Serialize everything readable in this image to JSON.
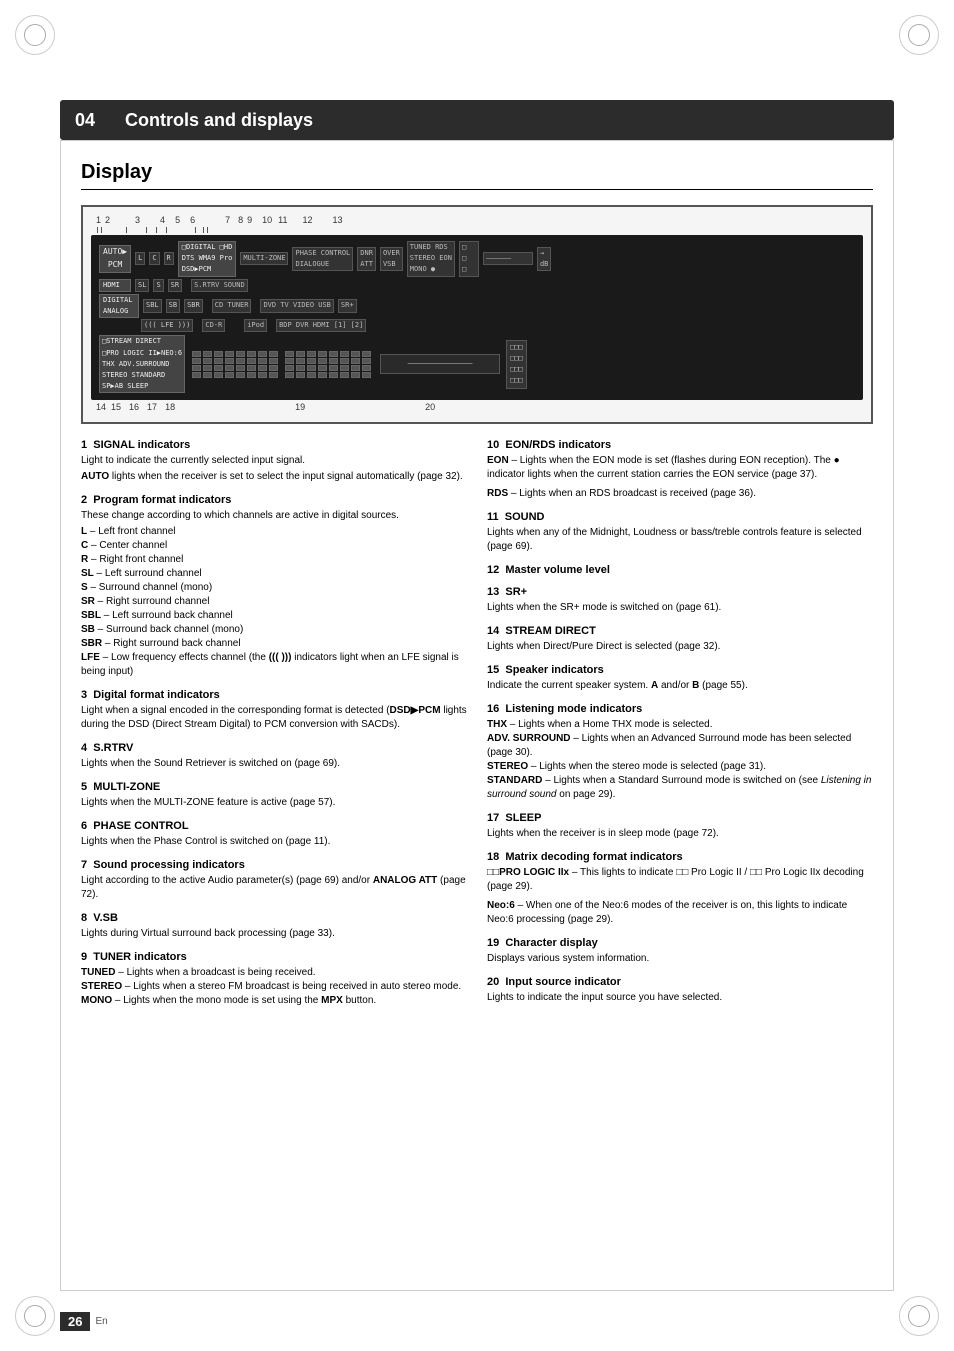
{
  "header": {
    "chapter_num": "04",
    "title": "Controls and displays"
  },
  "section": {
    "title": "Display"
  },
  "diagram": {
    "top_numbers": "1         2              3    4   5        6                7  8  9      10 11        12    13",
    "bottom_numbers": "14  15   16   17  18                                           19                              20"
  },
  "descriptions_left": [
    {
      "num": "1",
      "title": "SIGNAL indicators",
      "text": "Light to indicate the currently selected input signal.",
      "items": [
        "AUTO lights when the receiver is set to select the input signal automatically (page 32)."
      ]
    },
    {
      "num": "2",
      "title": "Program format indicators",
      "text": "These change according to which channels are active in digital sources.",
      "items": [
        "L – Left front channel",
        "C – Center channel",
        "R – Right front channel",
        "SL – Left surround channel",
        "S – Surround channel (mono)",
        "SR – Right surround channel",
        "SBL – Left surround back channel",
        "SB – Surround back channel (mono)",
        "SBR – Right surround back channel",
        "LFE – Low frequency effects channel (the ((( ))) indicators light when an LFE signal is being input)"
      ]
    },
    {
      "num": "3",
      "title": "Digital format indicators",
      "text": "Light when a signal encoded in the corresponding format is detected (DSD▶PCM lights during the DSD (Direct Stream Digital) to PCM conversion with SACDs)."
    },
    {
      "num": "4",
      "title": "S.RTRV",
      "text": "Lights when the Sound Retriever is switched on (page 69)."
    },
    {
      "num": "5",
      "title": "MULTI-ZONE",
      "text": "Lights when the MULTI-ZONE feature is active (page 57)."
    },
    {
      "num": "6",
      "title": "PHASE CONTROL",
      "text": "Lights when the Phase Control is switched on (page 11)."
    },
    {
      "num": "7",
      "title": "Sound processing indicators",
      "text": "Light according to the active Audio parameter(s) (page 69) and/or ANALOG ATT (page 72)."
    },
    {
      "num": "8",
      "title": "V.SB",
      "text": "Lights during Virtual surround back processing (page 33)."
    },
    {
      "num": "9",
      "title": "TUNER indicators",
      "items": [
        "TUNED – Lights when a broadcast is being received.",
        "STEREO – Lights when a stereo FM broadcast is being received in auto stereo mode.",
        "MONO – Lights when the mono mode is set using the MPX button."
      ]
    }
  ],
  "descriptions_right": [
    {
      "num": "10",
      "title": "EON/RDS indicators",
      "items": [
        "EON – Lights when the EON mode is set (flashes during EON reception). The ● indicator lights when the current station carries the EON service (page 37).",
        "RDS – Lights when an RDS broadcast is received (page 36)."
      ]
    },
    {
      "num": "11",
      "title": "SOUND",
      "text": "Lights when any of the Midnight, Loudness or bass/treble controls feature is selected (page 69)."
    },
    {
      "num": "12",
      "title": "Master volume level"
    },
    {
      "num": "13",
      "title": "SR+",
      "text": "Lights when the SR+ mode is switched on (page 61)."
    },
    {
      "num": "14",
      "title": "STREAM DIRECT",
      "text": "Lights when Direct/Pure Direct is selected (page 32)."
    },
    {
      "num": "15",
      "title": "Speaker indicators",
      "text": "Indicate the current speaker system. A and/or B (page 55)."
    },
    {
      "num": "16",
      "title": "Listening mode indicators",
      "items": [
        "THX – Lights when a Home THX mode is selected.",
        "ADV. SURROUND – Lights when an Advanced Surround mode has been selected (page 30).",
        "STEREO – Lights when the stereo mode is selected (page 31).",
        "STANDARD – Lights when a Standard Surround mode is switched on (see Listening in surround sound on page 29)."
      ]
    },
    {
      "num": "17",
      "title": "SLEEP",
      "text": "Lights when the receiver is in sleep mode (page 72)."
    },
    {
      "num": "18",
      "title": "Matrix decoding format indicators",
      "items": [
        "□□PRO LOGIC IIx – This lights to indicate □□ Pro Logic II / □□ Pro Logic IIx decoding (page 29).",
        "Neo:6 – When one of the Neo:6 modes of the receiver is on, this lights to indicate Neo:6 processing (page 29)."
      ]
    },
    {
      "num": "19",
      "title": "Character display",
      "text": "Displays various system information."
    },
    {
      "num": "20",
      "title": "Input source indicator",
      "text": "Lights to indicate the input source you have selected."
    }
  ],
  "page": {
    "number": "26",
    "lang": "En"
  }
}
